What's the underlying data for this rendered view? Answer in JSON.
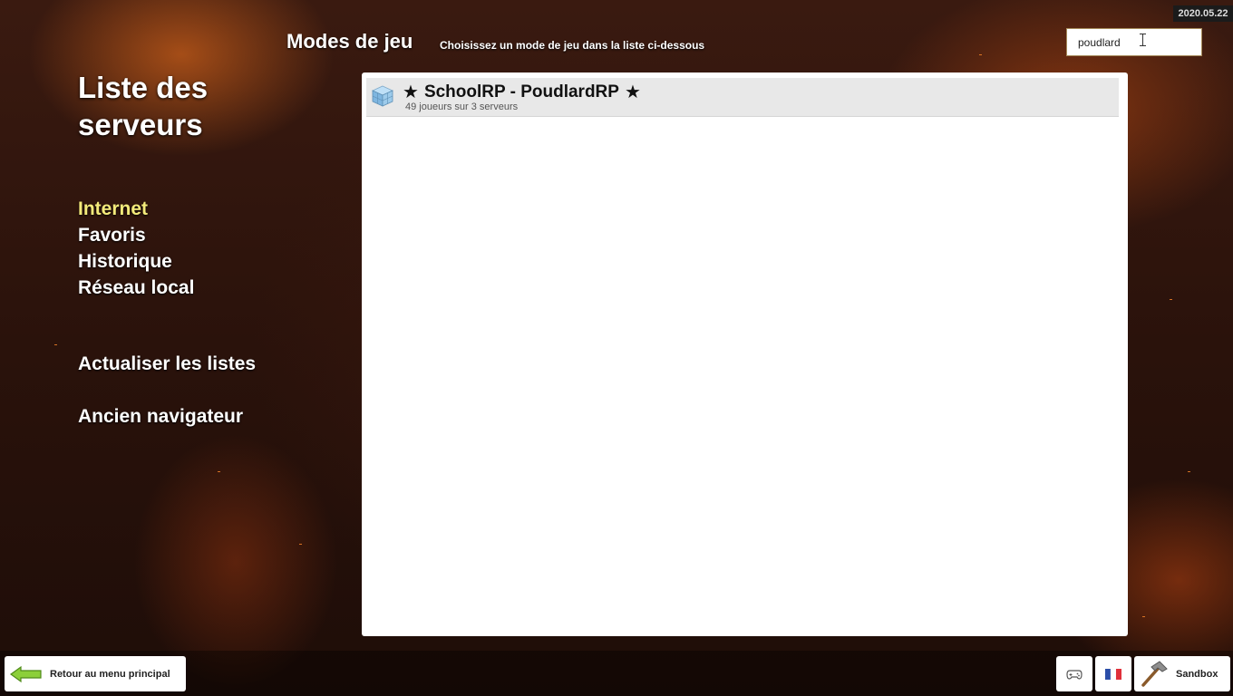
{
  "version": "2020.05.22",
  "header": {
    "title": "Modes de jeu",
    "subtitle": "Choisissez un mode de jeu dans la liste ci-dessous"
  },
  "search": {
    "value": "poudlard",
    "placeholder": ""
  },
  "sidebar": {
    "title": "Liste des serveurs",
    "items": [
      {
        "label": "Internet",
        "active": true
      },
      {
        "label": "Favoris",
        "active": false
      },
      {
        "label": "Historique",
        "active": false
      },
      {
        "label": "Réseau local",
        "active": false
      }
    ],
    "refresh_label": "Actualiser les listes",
    "legacy_label": "Ancien navigateur"
  },
  "gamemodes": [
    {
      "name": "SchoolRP - PoudlardRP",
      "star_left": "★",
      "star_right": "★",
      "info": "49 joueurs sur 3 serveurs",
      "icon": "cube-icon"
    }
  ],
  "footer": {
    "back_label": "Retour au menu principal",
    "controller_icon": "gamepad-icon",
    "language_icon": "french-flag-icon",
    "gamemode_label": "Sandbox",
    "gamemode_icon": "hammer-icon"
  },
  "colors": {
    "active_nav": "#f4ea7a",
    "nav": "#ffffff",
    "panel_bg": "#ffffff",
    "row_bg": "#e8e8e8"
  }
}
